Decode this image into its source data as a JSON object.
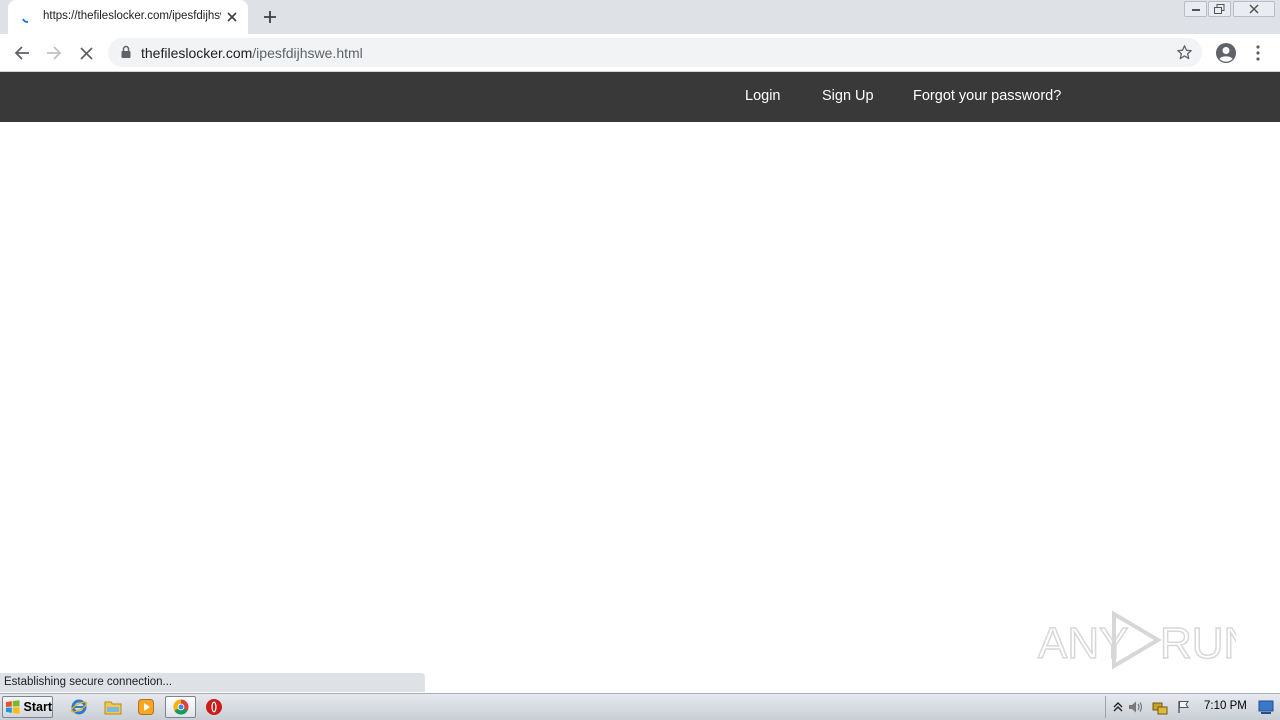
{
  "browser": {
    "tab_title": "https://thefileslocker.com/ipesfdijhswe.html",
    "url_host": "thefileslocker.com",
    "url_path": "/ipesfdijhswe.html",
    "icons": {
      "favicon": "loading-spinner-icon",
      "tab_close": "close-icon",
      "new_tab": "plus-icon",
      "back": "arrow-left-icon",
      "forward": "arrow-right-icon",
      "stop": "close-icon",
      "lock": "lock-icon",
      "bookmark": "star-icon",
      "profile": "account-circle-icon",
      "menu": "more-vert-icon"
    }
  },
  "site": {
    "nav": {
      "login": "Login",
      "signup": "Sign Up",
      "forgot": "Forgot your password?"
    },
    "header_color": "#393939"
  },
  "status": {
    "text": "Establishing secure connection..."
  },
  "watermark": {
    "text": "ANY RUN"
  },
  "taskbar": {
    "start_label": "Start",
    "apps": [
      "internet-explorer-icon",
      "file-explorer-icon",
      "media-player-icon",
      "chrome-icon",
      "opera-icon"
    ],
    "clock": "7:10 PM"
  }
}
